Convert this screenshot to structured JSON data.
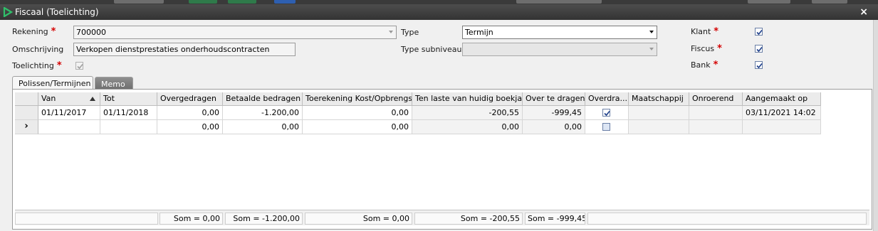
{
  "window": {
    "title": "Fiscaal (Toelichting)",
    "close_label": "×"
  },
  "form": {
    "rekening": {
      "label": "Rekening",
      "value": "700000"
    },
    "omschrijving": {
      "label": "Omschrijving",
      "value": "Verkopen dienstprestaties onderhoudscontracten"
    },
    "toelichting": {
      "label": "Toelichting",
      "checked": true
    },
    "type": {
      "label": "Type",
      "value": "Termijn"
    },
    "type_subniveau": {
      "label": "Type subniveau",
      "value": ""
    },
    "klant": {
      "label": "Klant",
      "checked": true
    },
    "fiscus": {
      "label": "Fiscus",
      "checked": true
    },
    "bank": {
      "label": "Bank",
      "checked": true
    },
    "required_mark": "*"
  },
  "tabs": [
    {
      "label": "Polissen/Termijnen",
      "active": true
    },
    {
      "label": "Memo",
      "active": false
    }
  ],
  "grid": {
    "columns": [
      "Van",
      "Tot",
      "Overgedragen",
      "Betaalde bedragen",
      "Toerekening Kost/Opbrengst",
      "Ten laste van huidig boekjaar",
      "Over te dragen",
      "Overdra...",
      "Maatschappij",
      "Onroerend",
      "Aangemaakt op"
    ],
    "rows": [
      {
        "van": "01/11/2017",
        "tot": "01/11/2018",
        "overgedragen": "0,00",
        "betaalde": "-1.200,00",
        "toerekening": "0,00",
        "ten_laste": "-200,55",
        "over_te_dragen": "-999,45",
        "overdracht_checked": true,
        "maatschappij": "",
        "onroerend": "",
        "aangemaakt": "03/11/2021 14:02"
      },
      {
        "van": "",
        "tot": "",
        "overgedragen": "0,00",
        "betaalde": "0,00",
        "toerekening": "0,00",
        "ten_laste": "0,00",
        "over_te_dragen": "0,00",
        "overdracht_checked": false,
        "maatschappij": "",
        "onroerend": "",
        "aangemaakt": ""
      }
    ],
    "new_row_indicator": "›",
    "totals": {
      "overgedragen": "Som = 0,00",
      "betaalde": "Som = -1.200,00",
      "toerekening": "Som = 0,00",
      "ten_laste": "Som = -200,55",
      "over_te_dragen": "Som = -999,45"
    }
  },
  "colors": {
    "titlebar": "#3c3c3c",
    "required": "#d40000",
    "checkbox_border": "#6a7fa6",
    "checkmark": "#1e3f8a"
  }
}
